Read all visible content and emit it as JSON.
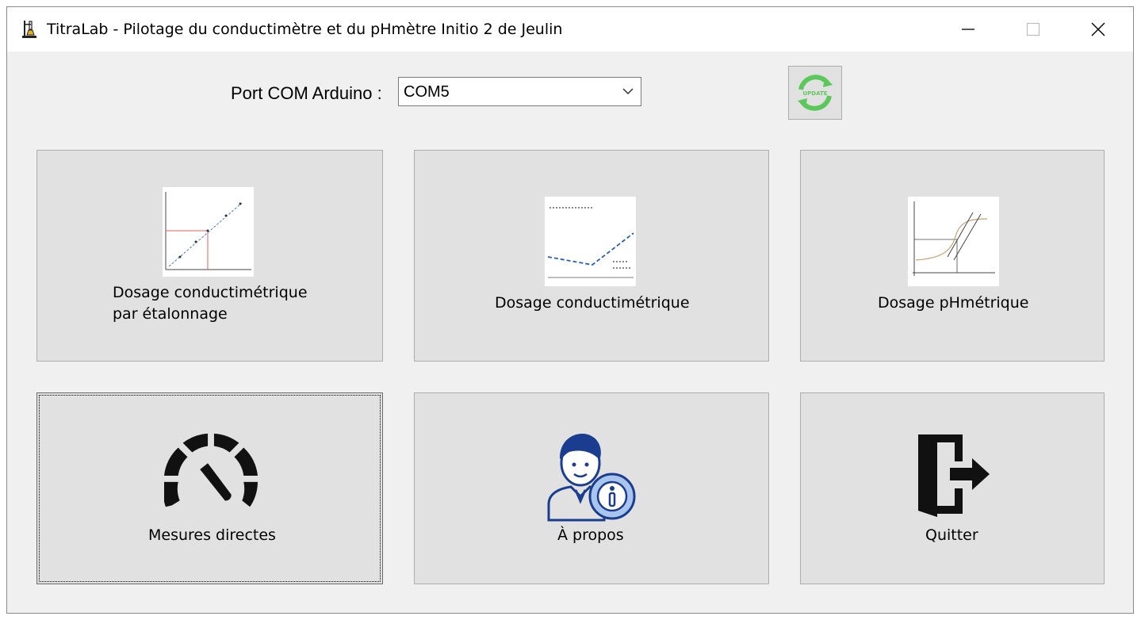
{
  "window": {
    "title": "TitraLab - Pilotage du conductimètre et du pHmètre Initio 2 de Jeulin"
  },
  "icons": {
    "app": "lab-stand-icon",
    "minimize": "minimize-icon",
    "maximize": "maximize-icon",
    "close": "close-icon",
    "update": "update-refresh-icon"
  },
  "com": {
    "label": "Port COM Arduino :",
    "value": "COM5"
  },
  "update": {
    "label": "UPDATE"
  },
  "tiles": {
    "calibration": {
      "label": "Dosage conductimétrique\npar étalonnage"
    },
    "conductimetric": {
      "label": "Dosage conductimétrique"
    },
    "phmetric": {
      "label": "Dosage pHmétrique"
    },
    "direct": {
      "label": "Mesures directes"
    },
    "about": {
      "label": "À propos"
    },
    "quit": {
      "label": "Quitter"
    }
  },
  "colors": {
    "tile_bg": "#e1e1e1",
    "update_green": "#5cc85c",
    "about_blue": "#1a3d8f",
    "about_light": "#a9c5ee"
  }
}
